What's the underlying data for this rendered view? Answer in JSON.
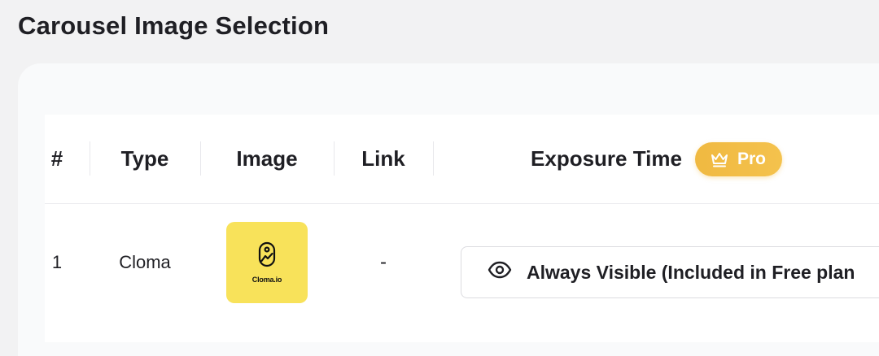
{
  "page": {
    "title": "Carousel Image Selection"
  },
  "table": {
    "columns": {
      "num": "#",
      "type": "Type",
      "image": "Image",
      "link": "Link",
      "exposure": "Exposure Time"
    },
    "pro_badge": {
      "label": "Pro",
      "icon": "crown-icon",
      "color": "#f0b941"
    },
    "rows": [
      {
        "num": "1",
        "type": "Cloma",
        "image": {
          "caption": "Cloma.io",
          "background": "#f8e25a",
          "icon": "cloma-logo-icon"
        },
        "link": "-",
        "exposure": {
          "label": "Always Visible (Included in Free plan",
          "icon": "eye-icon"
        }
      }
    ]
  }
}
